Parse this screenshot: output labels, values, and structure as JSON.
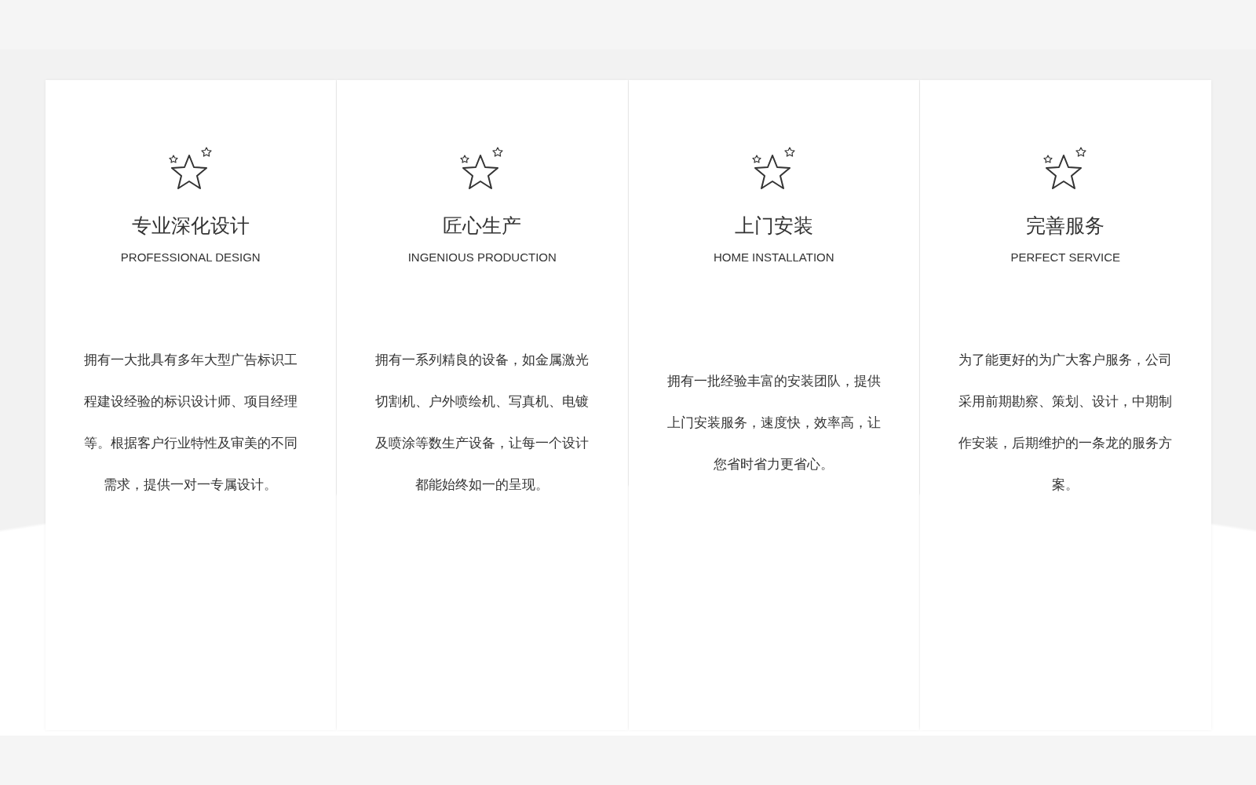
{
  "features": [
    {
      "title": "专业深化设计",
      "subtitle": "PROFESSIONAL DESIGN",
      "description": "拥有一大批具有多年大型广告标识工程建设经验的标识设计师、项目经理等。根据客户行业特性及审美的不同需求，提供一对一专属设计。"
    },
    {
      "title": "匠心生产",
      "subtitle": "INGENIOUS PRODUCTION",
      "description": "拥有一系列精良的设备，如金属激光切割机、户外喷绘机、写真机、电镀及喷涂等数生产设备，让每一个设计都能始终如一的呈现。"
    },
    {
      "title": "上门安装",
      "subtitle": "HOME INSTALLATION",
      "description": "拥有一批经验丰富的安装团队，提供上门安装服务，速度快，效率高，让您省时省力更省心。"
    },
    {
      "title": "完善服务",
      "subtitle": "PERFECT SERVICE",
      "description": "为了能更好的为广大客户服务，公司采用前期勘察、策划、设计，中期制作安装，后期维护的一条龙的服务方案。"
    }
  ]
}
